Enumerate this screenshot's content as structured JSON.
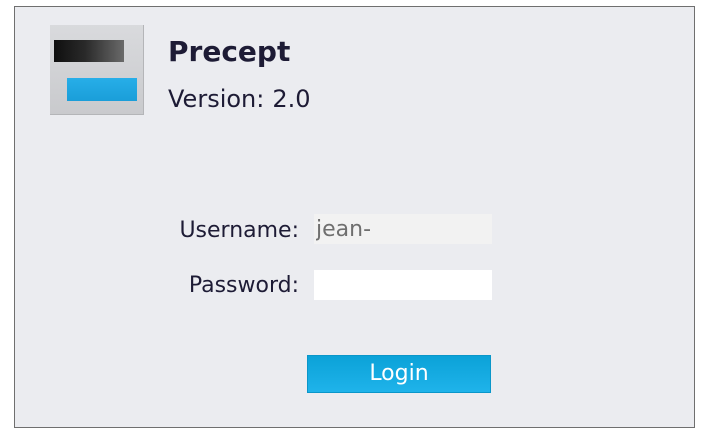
{
  "app": {
    "name": "Precept",
    "version_label": "Version:",
    "version_value": "2.0"
  },
  "login_form": {
    "username_label": "Username:",
    "username_value": "jean-",
    "password_label": "Password:",
    "password_value": "",
    "login_label": "Login"
  },
  "icons": {
    "logo": "app-logo-icon"
  },
  "colors": {
    "background": "#ebecf0",
    "accent": "#1fb3ea",
    "text": "#1d1b35"
  }
}
